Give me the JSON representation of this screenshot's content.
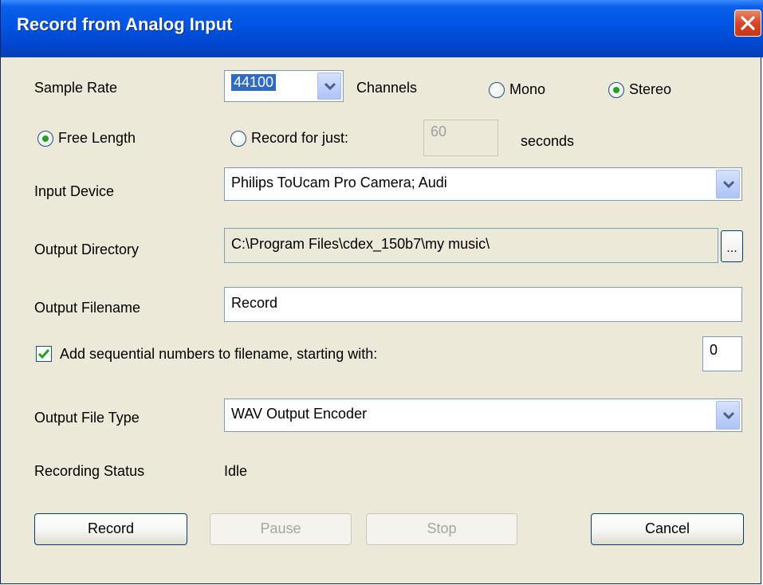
{
  "window": {
    "title": "Record from Analog Input"
  },
  "sample_rate": {
    "label": "Sample Rate",
    "value": "44100"
  },
  "channels": {
    "label": "Channels",
    "mono": "Mono",
    "stereo": "Stereo",
    "selected": "Stereo"
  },
  "length": {
    "free": "Free Length",
    "record_for": "Record for just:",
    "seconds_value": "60",
    "seconds_label": "seconds",
    "selected": "Free Length"
  },
  "input_device": {
    "label": "Input Device",
    "value": "Philips ToUcam Pro Camera; Audi"
  },
  "output_directory": {
    "label": "Output Directory",
    "value": "C:\\Program Files\\cdex_150b7\\my music\\",
    "browse": "..."
  },
  "output_filename": {
    "label": "Output Filename",
    "value": "Record"
  },
  "sequential": {
    "label": "Add sequential numbers to filename, starting with:",
    "checked": true,
    "start_value": "0"
  },
  "output_file_type": {
    "label": "Output File Type",
    "value": "WAV Output Encoder"
  },
  "status": {
    "label": "Recording Status",
    "value": "Idle"
  },
  "buttons": {
    "record": "Record",
    "pause": "Pause",
    "stop": "Stop",
    "cancel": "Cancel"
  },
  "icons": {
    "close": "close-icon",
    "dropdown": "chevron-down-icon",
    "checkmark": "checkmark-icon"
  }
}
